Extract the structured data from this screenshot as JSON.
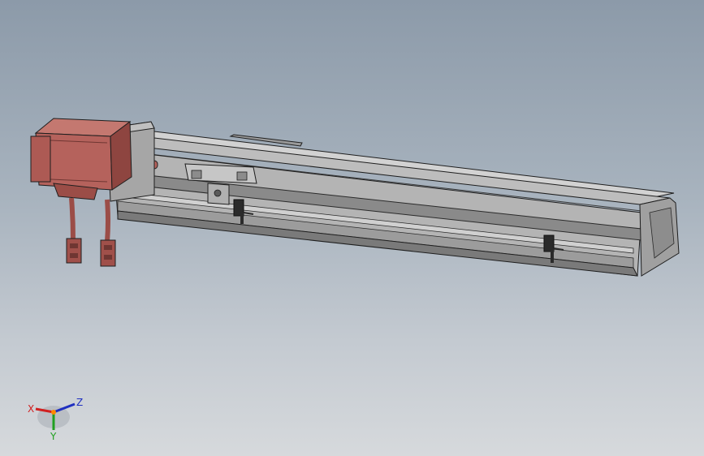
{
  "viewport": {
    "background_top": "#8c9aa9",
    "background_bottom": "#d6d9dc"
  },
  "model": {
    "assembly": "linear-actuator",
    "parts": [
      "servo-motor",
      "motor-flange",
      "rail-profile",
      "carriage",
      "limit-sensor",
      "limit-sensor",
      "end-cap",
      "cable-connector",
      "cable-connector"
    ],
    "colors": {
      "motor": "#b5625c",
      "motor_dark": "#8e4540",
      "rail_light": "#c8c8c8",
      "rail_mid": "#a8a8a8",
      "rail_dark": "#6e6e6e",
      "sensor": "#2b2b2b",
      "edge": "#1e1e1e"
    }
  },
  "triad": {
    "x_label": "X",
    "y_label": "Y",
    "z_label": "Z",
    "x_color": "#d02020",
    "y_color": "#20a020",
    "z_color": "#2030c0"
  }
}
